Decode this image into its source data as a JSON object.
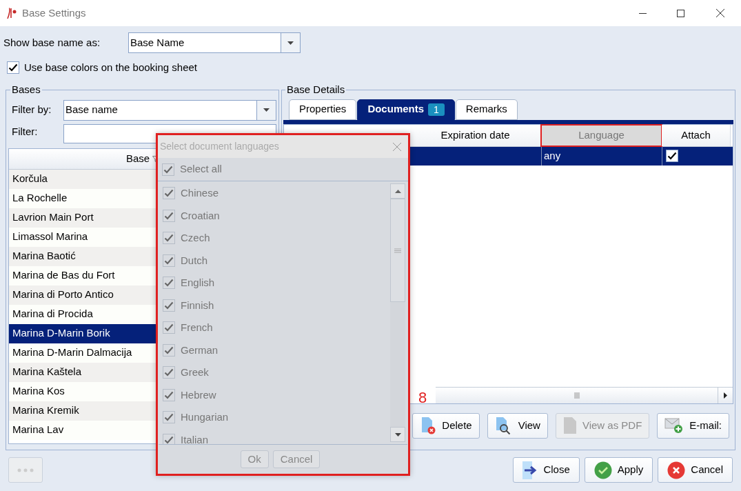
{
  "window": {
    "title": "Base Settings"
  },
  "show_base_name_as": {
    "label": "Show base name as:",
    "value": "Base Name"
  },
  "use_base_colors": {
    "label": "Use base colors on the booking sheet",
    "checked": true
  },
  "bases": {
    "title": "Bases",
    "filter_by": {
      "label": "Filter by:",
      "value": "Base name"
    },
    "filter": {
      "label": "Filter:"
    },
    "column": "Base",
    "rows": [
      {
        "name": "Korčula",
        "selected": false
      },
      {
        "name": "La Rochelle",
        "selected": false
      },
      {
        "name": "Lavrion Main Port",
        "selected": false
      },
      {
        "name": "Limassol Marina",
        "selected": false
      },
      {
        "name": "Marina Baotić",
        "selected": false
      },
      {
        "name": "Marina de Bas du Fort",
        "selected": false
      },
      {
        "name": "Marina di Porto Antico",
        "selected": false
      },
      {
        "name": "Marina di Procida",
        "selected": false
      },
      {
        "name": "Marina D-Marin Borik",
        "selected": true
      },
      {
        "name": "Marina D-Marin Dalmacija",
        "selected": false
      },
      {
        "name": "Marina Kaštela",
        "selected": false
      },
      {
        "name": "Marina Kos",
        "selected": false
      },
      {
        "name": "Marina Kremik",
        "selected": false
      },
      {
        "name": "Marina Lav",
        "selected": false
      }
    ]
  },
  "base_details": {
    "title": "Base Details",
    "tabs": [
      {
        "label": "Properties",
        "selected": false
      },
      {
        "label": "Documents",
        "badge": "1",
        "selected": true
      },
      {
        "label": "Remarks",
        "selected": false
      }
    ],
    "columns": [
      {
        "label": "Expiration date",
        "highlighted": false
      },
      {
        "label": "Language",
        "highlighted": true
      },
      {
        "label": "Attach",
        "highlighted": false
      }
    ],
    "rows": [
      {
        "language": "any",
        "attach": true,
        "selected": true
      }
    ],
    "buttons": [
      {
        "label": "Delete",
        "kind": "delete",
        "disabled": false
      },
      {
        "label": "View",
        "kind": "view",
        "disabled": false
      },
      {
        "label": "View as PDF",
        "kind": "pdf",
        "disabled": true
      },
      {
        "label": "E-mail:",
        "kind": "email",
        "disabled": false
      }
    ]
  },
  "annotation": "8",
  "footer_buttons": [
    {
      "label": "Close",
      "kind": "close"
    },
    {
      "label": "Apply",
      "kind": "apply"
    },
    {
      "label": "Cancel",
      "kind": "cancel"
    }
  ],
  "language_dialog": {
    "title": "Select document languages",
    "highlighted": true,
    "select_all": {
      "label": "Select all",
      "checked": true
    },
    "languages": [
      {
        "label": "Chinese",
        "checked": true
      },
      {
        "label": "Croatian",
        "checked": true
      },
      {
        "label": "Czech",
        "checked": true
      },
      {
        "label": "Dutch",
        "checked": true
      },
      {
        "label": "English",
        "checked": true
      },
      {
        "label": "Finnish",
        "checked": true
      },
      {
        "label": "French",
        "checked": true
      },
      {
        "label": "German",
        "checked": true
      },
      {
        "label": "Greek",
        "checked": true
      },
      {
        "label": "Hebrew",
        "checked": true
      },
      {
        "label": "Hungarian",
        "checked": true
      },
      {
        "label": "Italian",
        "checked": true
      }
    ],
    "buttons": [
      "Ok",
      "Cancel"
    ]
  }
}
